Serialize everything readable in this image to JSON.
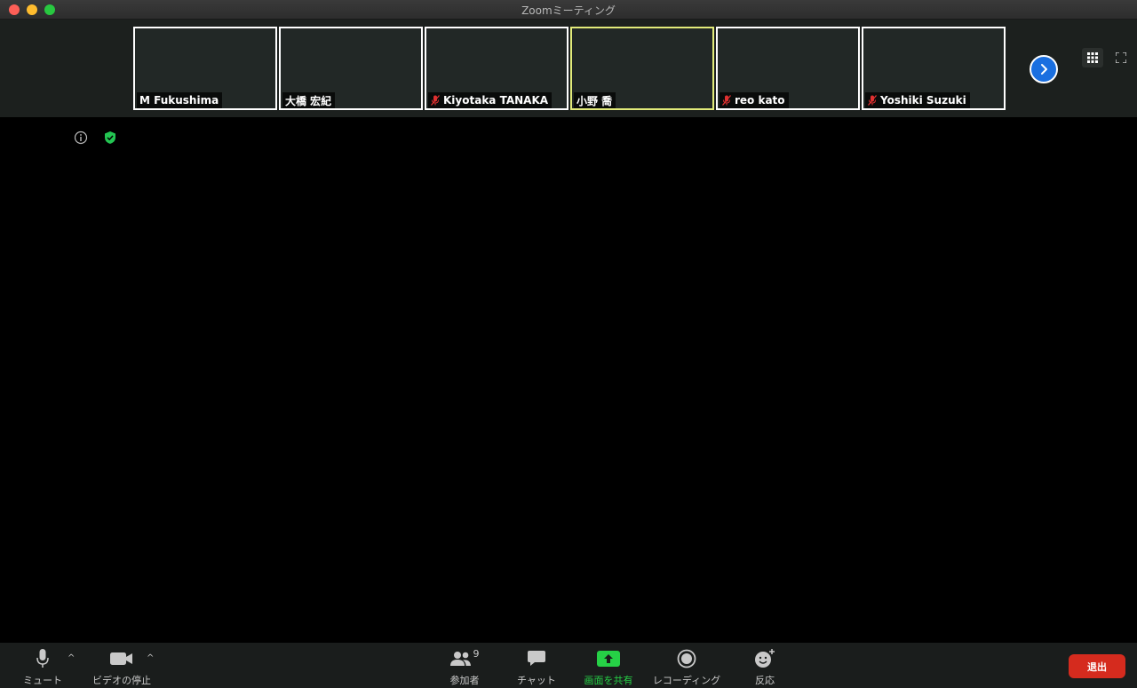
{
  "window": {
    "title": "Zoomミーティング"
  },
  "participants": [
    {
      "name": "M Fukushima",
      "muted": false,
      "active": false
    },
    {
      "name": "大橋 宏紀",
      "muted": false,
      "active": false
    },
    {
      "name": "Kiyotaka TANAKA",
      "muted": true,
      "active": false
    },
    {
      "name": "小野 喬",
      "muted": false,
      "active": true
    },
    {
      "name": "reo kato",
      "muted": true,
      "active": false
    },
    {
      "name": "Yoshiki Suzuki",
      "muted": true,
      "active": false
    }
  ],
  "toolbar": {
    "mute_label": "ミュート",
    "video_label": "ビデオの停止",
    "participants_label": "参加者",
    "participants_count": "9",
    "chat_label": "チャット",
    "share_label": "画面を共有",
    "record_label": "レコーディング",
    "reactions_label": "反応",
    "leave_label": "退出"
  },
  "colors": {
    "active_speaker_border": "#e2eb7a",
    "share_green": "#26d146",
    "leave_red": "#d52b1e",
    "next_blue": "#1a6fe0",
    "shield_green": "#23c552",
    "mute_red": "#e03030"
  },
  "icons": [
    "info-icon",
    "shield-icon",
    "microphone-icon",
    "video-camera-icon",
    "participants-icon",
    "chat-icon",
    "share-screen-icon",
    "record-icon",
    "reaction-icon",
    "grid-view-icon",
    "fullscreen-icon",
    "chevron-right-icon"
  ]
}
